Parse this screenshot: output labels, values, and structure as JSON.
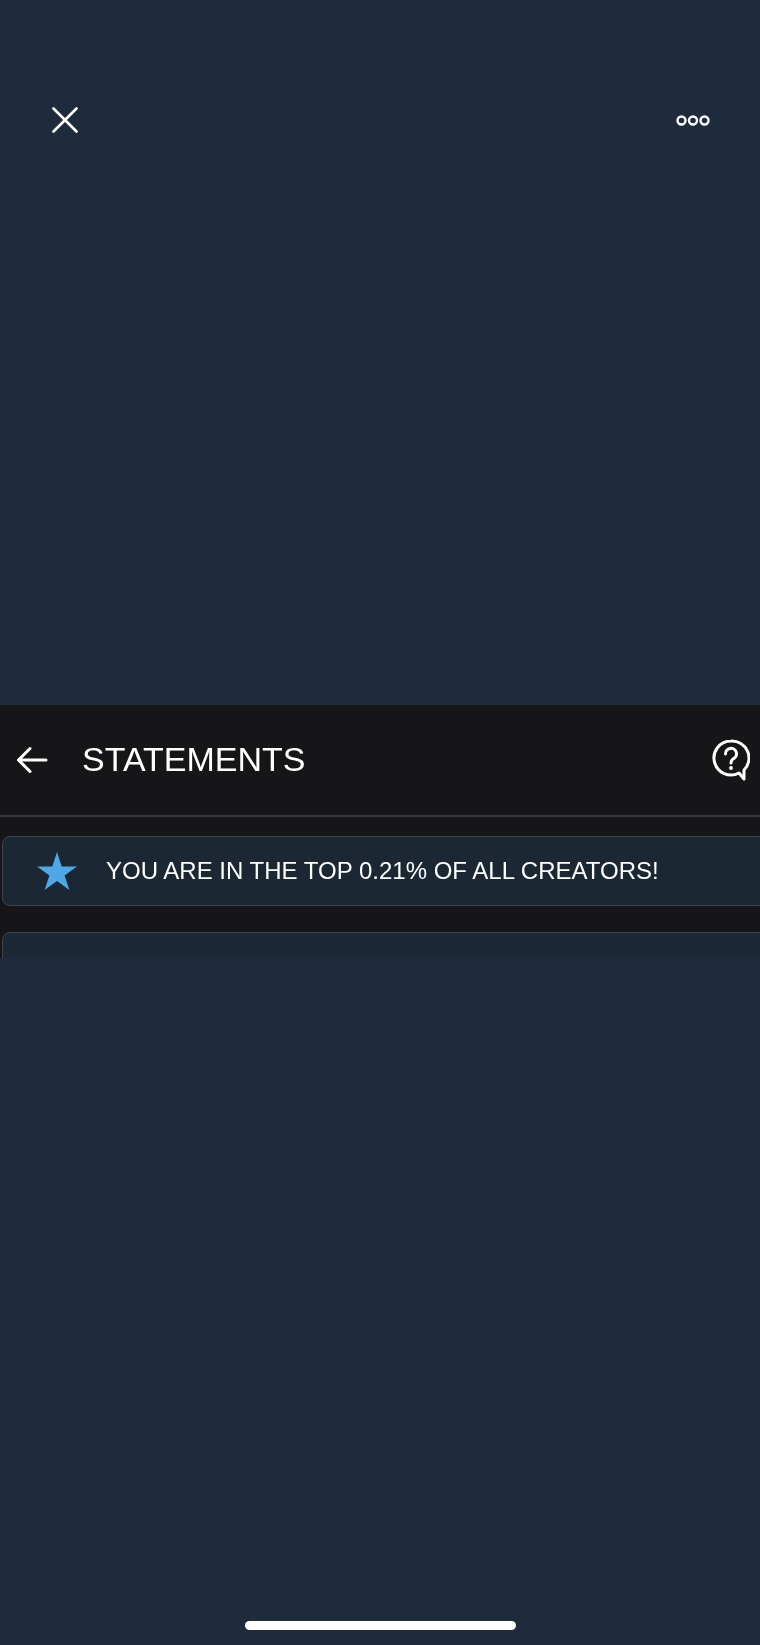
{
  "header": {
    "title": "STATEMENTS"
  },
  "banner": {
    "text": "YOU ARE IN THE TOP 0.21% OF ALL CREATORS!"
  }
}
